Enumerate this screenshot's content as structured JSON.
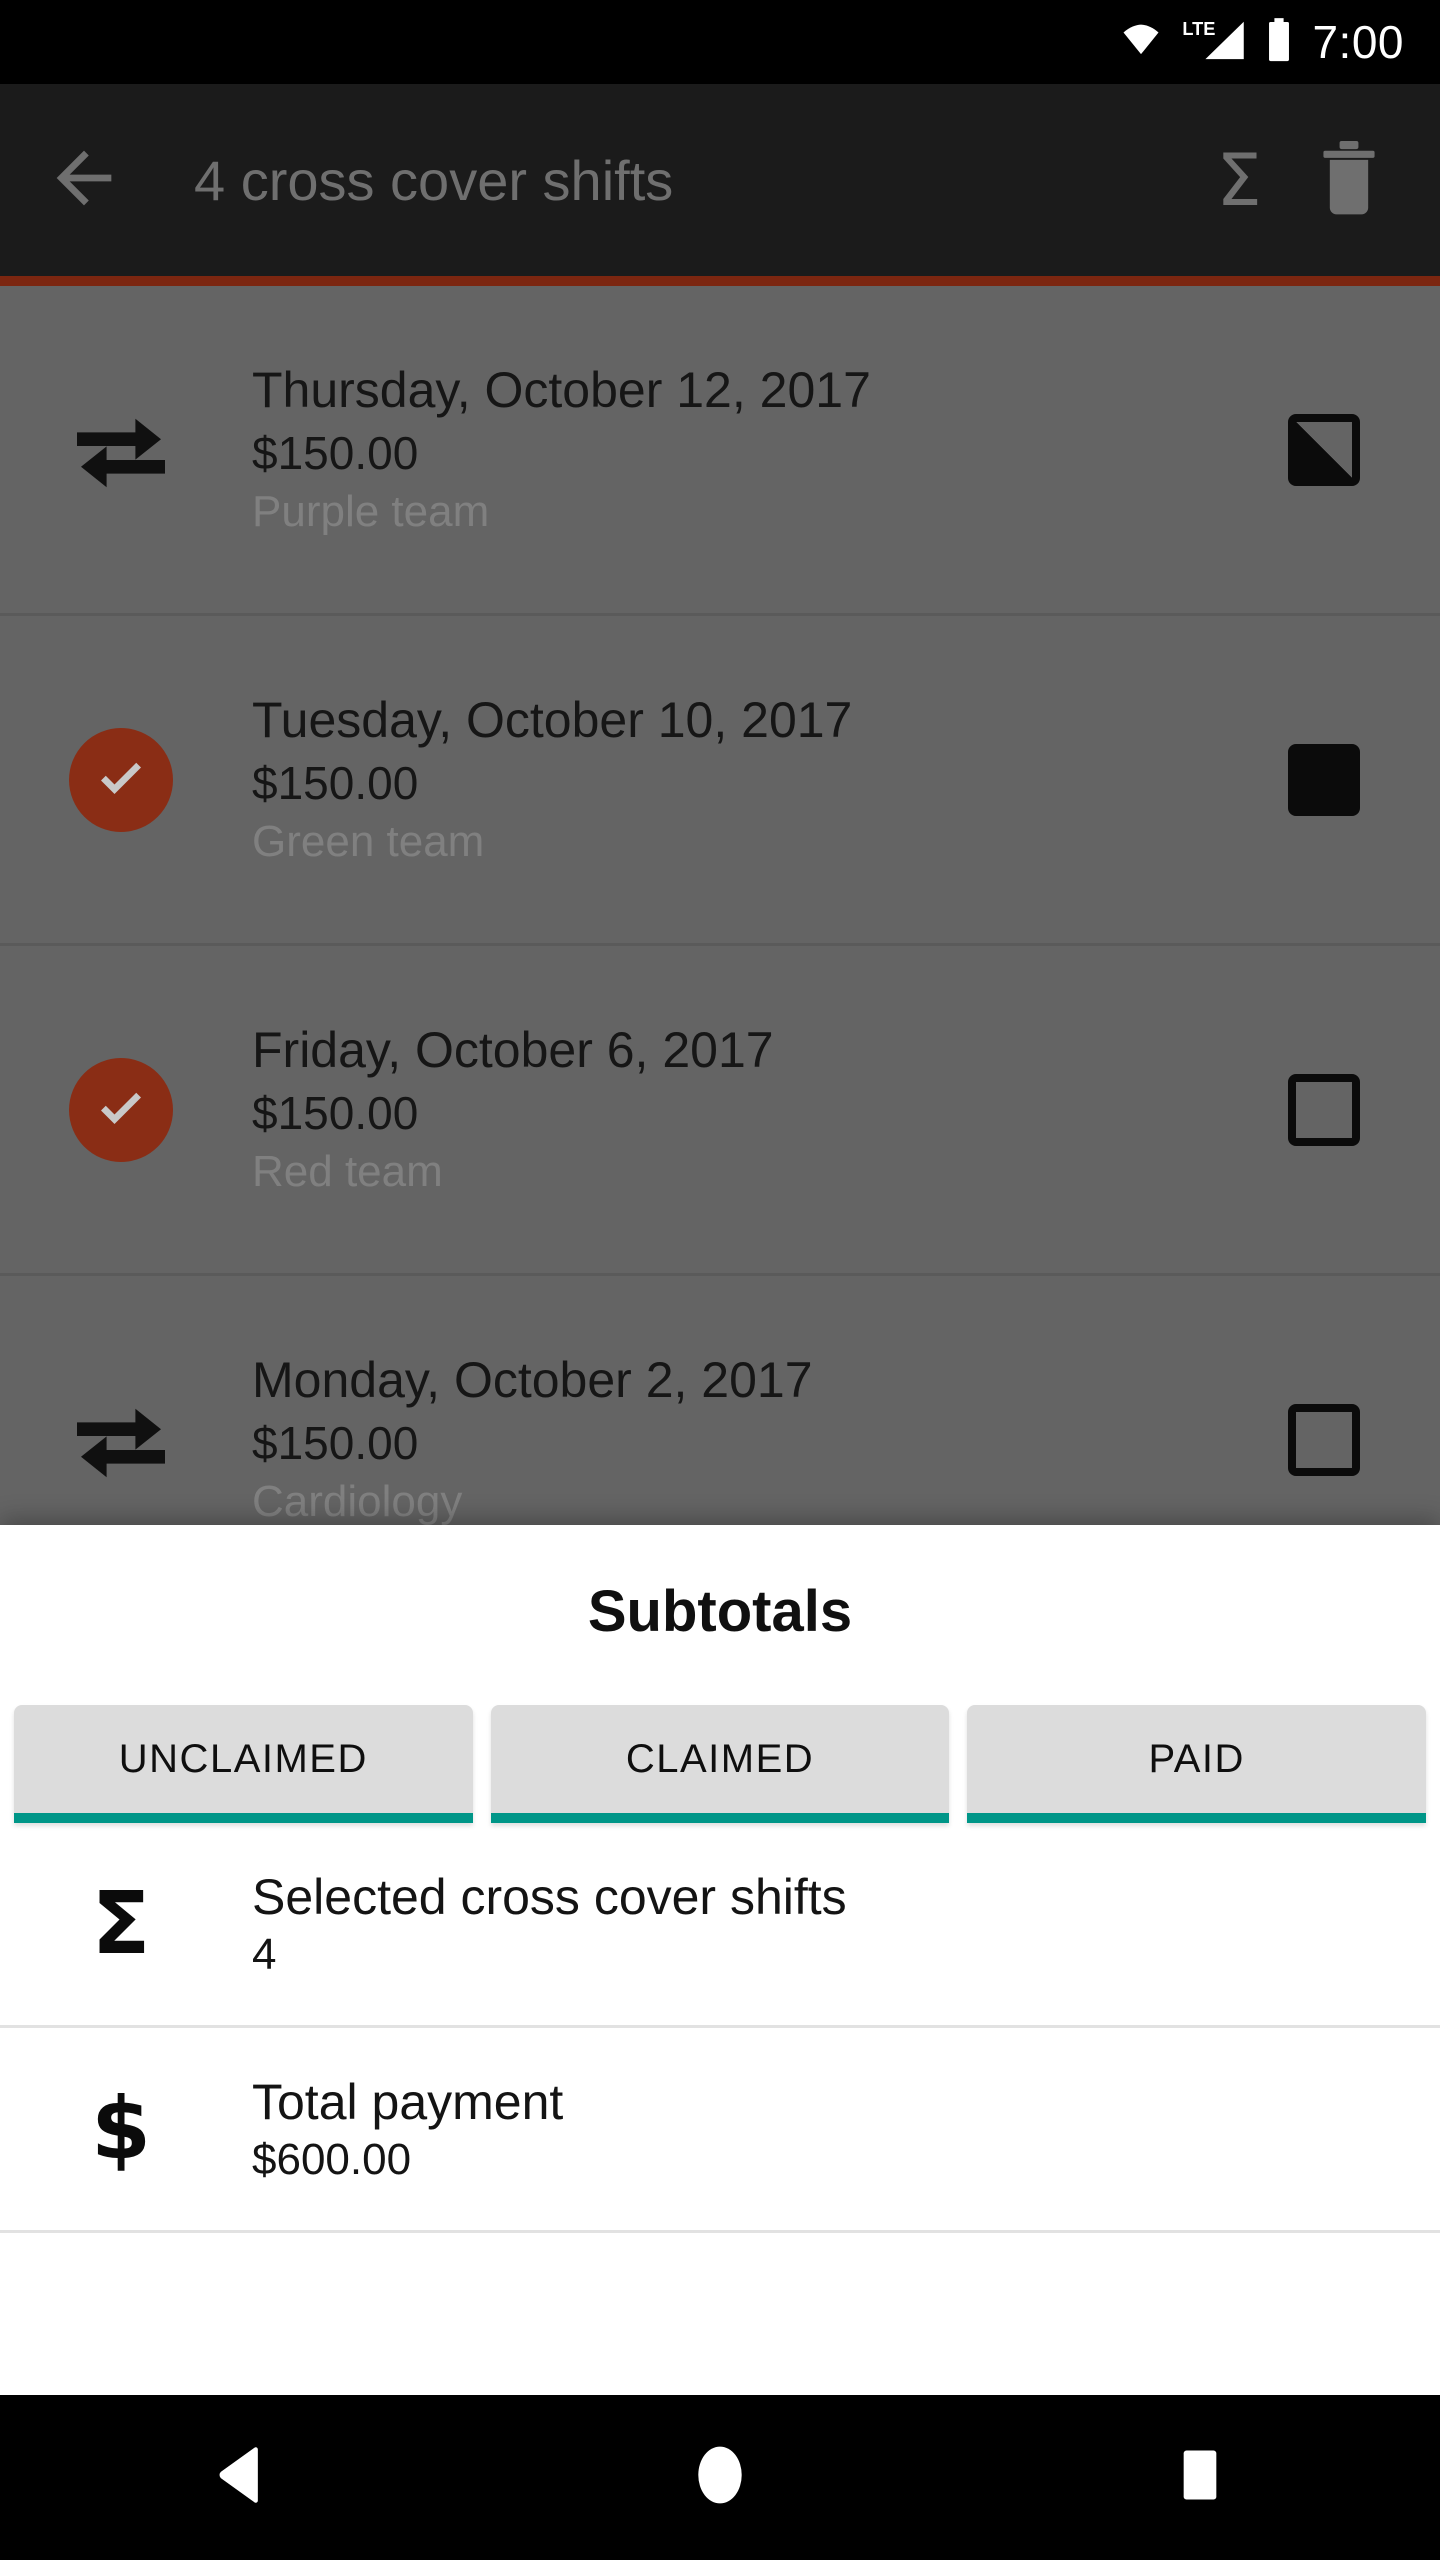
{
  "status_bar": {
    "time": "7:00",
    "network_label": "LTE",
    "icons": [
      "wifi-icon",
      "lte-signal-icon",
      "battery-icon"
    ]
  },
  "app_bar": {
    "back_icon": "back-arrow-icon",
    "title": "4 cross cover shifts",
    "actions": [
      {
        "name": "subtotals-action",
        "glyph": "Σ"
      },
      {
        "name": "delete-action",
        "glyph": "trash-icon"
      }
    ]
  },
  "theme": {
    "accent": "#7c2610",
    "tab_underline": "#009688",
    "check_circle": "#8a2d15",
    "scrim": "#646464",
    "appbar_bg": "#1b1b1b"
  },
  "shift_list": [
    {
      "lead_icon": "swap-arrows-icon",
      "date": "Thursday, October 12, 2017",
      "amount": "$150.00",
      "team": "Purple team",
      "checkbox_state": "half"
    },
    {
      "lead_icon": "check-circle-icon",
      "date": "Tuesday, October 10, 2017",
      "amount": "$150.00",
      "team": "Green team",
      "checkbox_state": "filled"
    },
    {
      "lead_icon": "check-circle-icon",
      "date": "Friday, October 6, 2017",
      "amount": "$150.00",
      "team": "Red team",
      "checkbox_state": "empty"
    },
    {
      "lead_icon": "swap-arrows-icon",
      "date": "Monday, October 2, 2017",
      "amount": "$150.00",
      "team": "Cardiology",
      "checkbox_state": "empty"
    }
  ],
  "sheet": {
    "title": "Subtotals",
    "tabs": [
      {
        "label": "UNCLAIMED",
        "selected": true
      },
      {
        "label": "CLAIMED",
        "selected": true
      },
      {
        "label": "PAID",
        "selected": true
      }
    ],
    "rows": [
      {
        "icon": "sigma-icon",
        "glyph": "Σ",
        "title": "Selected cross cover shifts",
        "value": "4"
      },
      {
        "icon": "dollar-icon",
        "glyph": "$",
        "title": "Total payment",
        "value": "$600.00"
      }
    ]
  },
  "nav_bar": {
    "buttons": [
      {
        "name": "nav-back-button",
        "icon": "triangle-back-icon"
      },
      {
        "name": "nav-home-button",
        "icon": "circle-home-icon"
      },
      {
        "name": "nav-recents-button",
        "icon": "square-recents-icon"
      }
    ]
  }
}
